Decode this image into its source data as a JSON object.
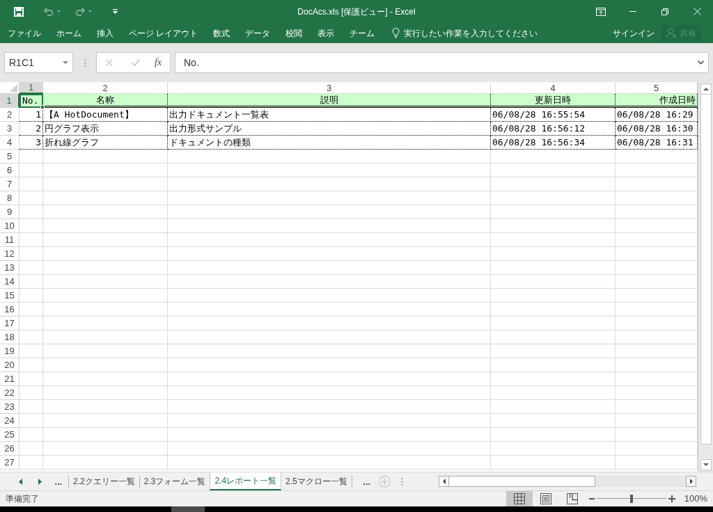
{
  "window": {
    "title": "DocAcs.xls [保護ビュー] - Excel"
  },
  "quick_access": [
    {
      "kind": "save",
      "disabled": false
    },
    {
      "kind": "undo",
      "disabled": true
    },
    {
      "kind": "redo",
      "disabled": true
    },
    {
      "kind": "customize",
      "disabled": false
    }
  ],
  "ribbon_tabs": [
    "ファイル",
    "ホーム",
    "挿入",
    "ページ レイアウト",
    "数式",
    "データ",
    "校閲",
    "表示",
    "チーム"
  ],
  "tell_me": {
    "placeholder": "実行したい作業を入力してください"
  },
  "account": {
    "sign_in": "サインイン",
    "share": {
      "label": "共有",
      "disabled": true
    }
  },
  "formula_bar": {
    "name_box": "R1C1",
    "cancel_disabled": true,
    "enter_disabled": true,
    "function_label": "fx",
    "formula": "No."
  },
  "sheet": {
    "columns": [
      {
        "label": "1",
        "selected": true
      },
      {
        "label": "2",
        "selected": false
      },
      {
        "label": "3",
        "selected": false
      },
      {
        "label": "4",
        "selected": false
      },
      {
        "label": "5",
        "selected": false
      }
    ],
    "row_headers": [
      {
        "label": "1",
        "selected": true
      },
      {
        "label": "2",
        "selected": false
      },
      {
        "label": "3",
        "selected": false
      },
      {
        "label": "4",
        "selected": false
      },
      {
        "label": "5",
        "selected": false
      },
      {
        "label": "6",
        "selected": false
      },
      {
        "label": "7",
        "selected": false
      },
      {
        "label": "8",
        "selected": false
      },
      {
        "label": "9",
        "selected": false
      },
      {
        "label": "10",
        "selected": false
      },
      {
        "label": "11",
        "selected": false
      },
      {
        "label": "12",
        "selected": false
      },
      {
        "label": "13",
        "selected": false
      },
      {
        "label": "14",
        "selected": false
      },
      {
        "label": "15",
        "selected": false
      },
      {
        "label": "16",
        "selected": false
      },
      {
        "label": "17",
        "selected": false
      },
      {
        "label": "18",
        "selected": false
      },
      {
        "label": "19",
        "selected": false
      },
      {
        "label": "20",
        "selected": false
      },
      {
        "label": "21",
        "selected": false
      },
      {
        "label": "22",
        "selected": false
      },
      {
        "label": "23",
        "selected": false
      },
      {
        "label": "24",
        "selected": false
      },
      {
        "label": "25",
        "selected": false
      },
      {
        "label": "26",
        "selected": false
      },
      {
        "label": "27",
        "selected": false
      }
    ],
    "header_row": [
      "No.",
      "名称",
      "説明",
      "更新日時",
      "作成日時"
    ],
    "data_rows": [
      [
        "1",
        "【A HotDocument】",
        "出力ドキュメント一覧表",
        "06/08/28 16:55:54",
        "06/08/28 16:29"
      ],
      [
        "2",
        "円グラフ表示",
        "出力形式サンプル",
        "06/08/28 16:56:12",
        "06/08/28 16:30"
      ],
      [
        "3",
        "折れ線グラフ",
        "ドキュメントの種類",
        "06/08/28 16:56:34",
        "06/08/28 16:31"
      ]
    ]
  },
  "sheet_tabs": {
    "more_left": "...",
    "tabs": [
      {
        "label": "2.2クエリー一覧",
        "selected": false
      },
      {
        "label": "2.3フォーム一覧",
        "selected": false
      },
      {
        "label": "2.4レポート一覧",
        "selected": true
      },
      {
        "label": "2.5マクロー一覧",
        "selected": false
      }
    ],
    "more_right": "..."
  },
  "status_bar": {
    "status": "準備完了",
    "views": [
      {
        "kind": "normal",
        "selected": true
      },
      {
        "kind": "page_layout",
        "selected": false
      },
      {
        "kind": "page_break",
        "selected": false
      }
    ],
    "zoom": {
      "level": 0.5,
      "reading": "100%"
    }
  }
}
